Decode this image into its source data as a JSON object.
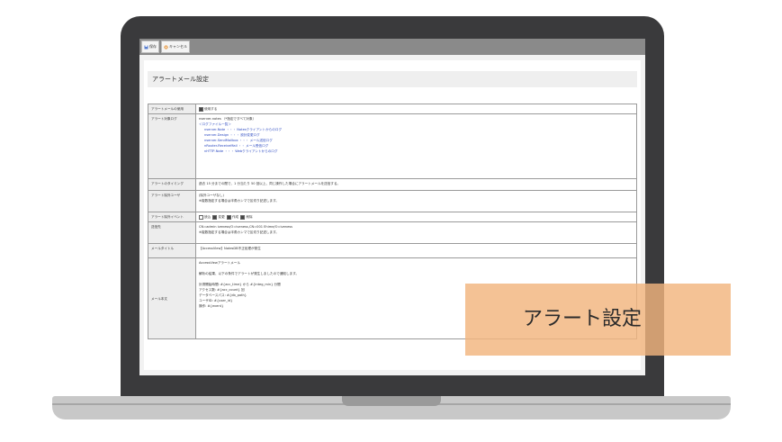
{
  "toolbar": {
    "save_label": "保存",
    "cancel_label": "キャンセル"
  },
  "page_title": "アラートメール設定",
  "rows": {
    "use": {
      "label": "アラートメールの使用",
      "value": "使用する"
    },
    "logs": {
      "label": "アラート対象ログ",
      "line1": "nserver-notes （*指定ですべて対象）",
      "link": "＜ログファイル一覧＞",
      "items": [
        "nserver-Note ・・・ Notesクライアントからのログ",
        "nserver-Design ・・・ 設計変更ログ",
        "nserver-SendMailbox ・・・ メール送信ログ",
        "nRouter-ReceiveMail ・・ メール受信ログ",
        "nHTTP-Note ・・・ Webクライアントからのログ"
      ]
    },
    "timing": {
      "label": "アラートのタイミング",
      "value": "過去 15 分までの間で、1 分当たり 50 回以上、同じ操作した場合にアラートメールを送信する。"
    },
    "exclude_user": {
      "label": "アラート除外ユーザ",
      "line1": "(除外ユーザなし)",
      "note": "※複数指定する場合は半角カンマで区切り記述します。"
    },
    "exclude_event": {
      "label": "アラート除外イベント",
      "items": [
        "読込",
        "変更",
        "作成",
        "削除"
      ],
      "checked": [
        false,
        true,
        true,
        true
      ]
    },
    "recipient": {
      "label": "送信先",
      "line1": "CN=admin iveness/O=iveness,CN=001 Ehime/O=iveness",
      "note": "※複数指定する場合は半角カンマで区切り記述します。"
    },
    "mail_title": {
      "label": "メールタイトル",
      "value": "【AccessView】NotesDB不正処理が発生"
    },
    "mail_body": {
      "label": "メール本文",
      "lines": [
        "AccessViewアラートメール",
        "解析の結果、以下の条件でアラートが発生しましたので通知します。",
        "計測開始時間: #{acc_time} から #{integ_min} 分間",
        "アクセス数: #{acc_count} 回",
        "データベースパス: #{db_path}",
        "ユーザID: #{user_id}",
        "操作: #{event}"
      ]
    }
  },
  "overlay_label": "アラート設定"
}
